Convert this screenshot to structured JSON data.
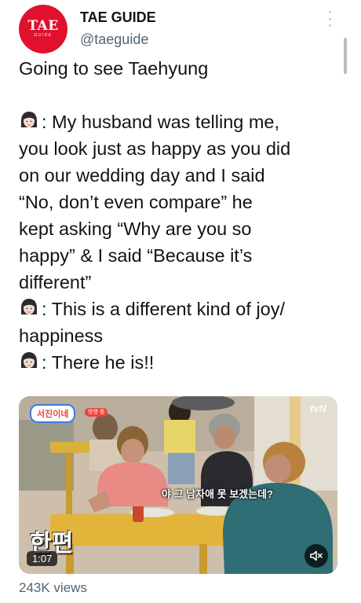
{
  "author": {
    "avatar_text": "TAE",
    "avatar_subtext": "GUIDE",
    "display_name": "TAE GUIDE",
    "handle": "@taeguide",
    "avatar_color": "#e1102c"
  },
  "tweet": {
    "lines": [
      "Going to see Taehyung",
      "",
      ": My husband was telling me,",
      "you look just as happy as you did",
      "on our wedding day and I said",
      "“No, don’t even compare” he",
      "kept asking “Why are you so",
      "happy” & I said “Because it’s",
      "different”",
      ": This is a different kind of joy/",
      "happiness",
      ": There he is!!"
    ],
    "emoji": "woman-emoji"
  },
  "media": {
    "show_logo": "서진이네",
    "show_badge": "방영 중",
    "channel_logo": "tvN",
    "subtitle": "야 그 남자애 못 보겠는데?",
    "episode_text": "한편",
    "duration": "1:07",
    "mute_icon": "speaker-muted-icon"
  },
  "stats": {
    "views": "243K views"
  },
  "icons": {
    "more": "more-vertical-icon"
  }
}
